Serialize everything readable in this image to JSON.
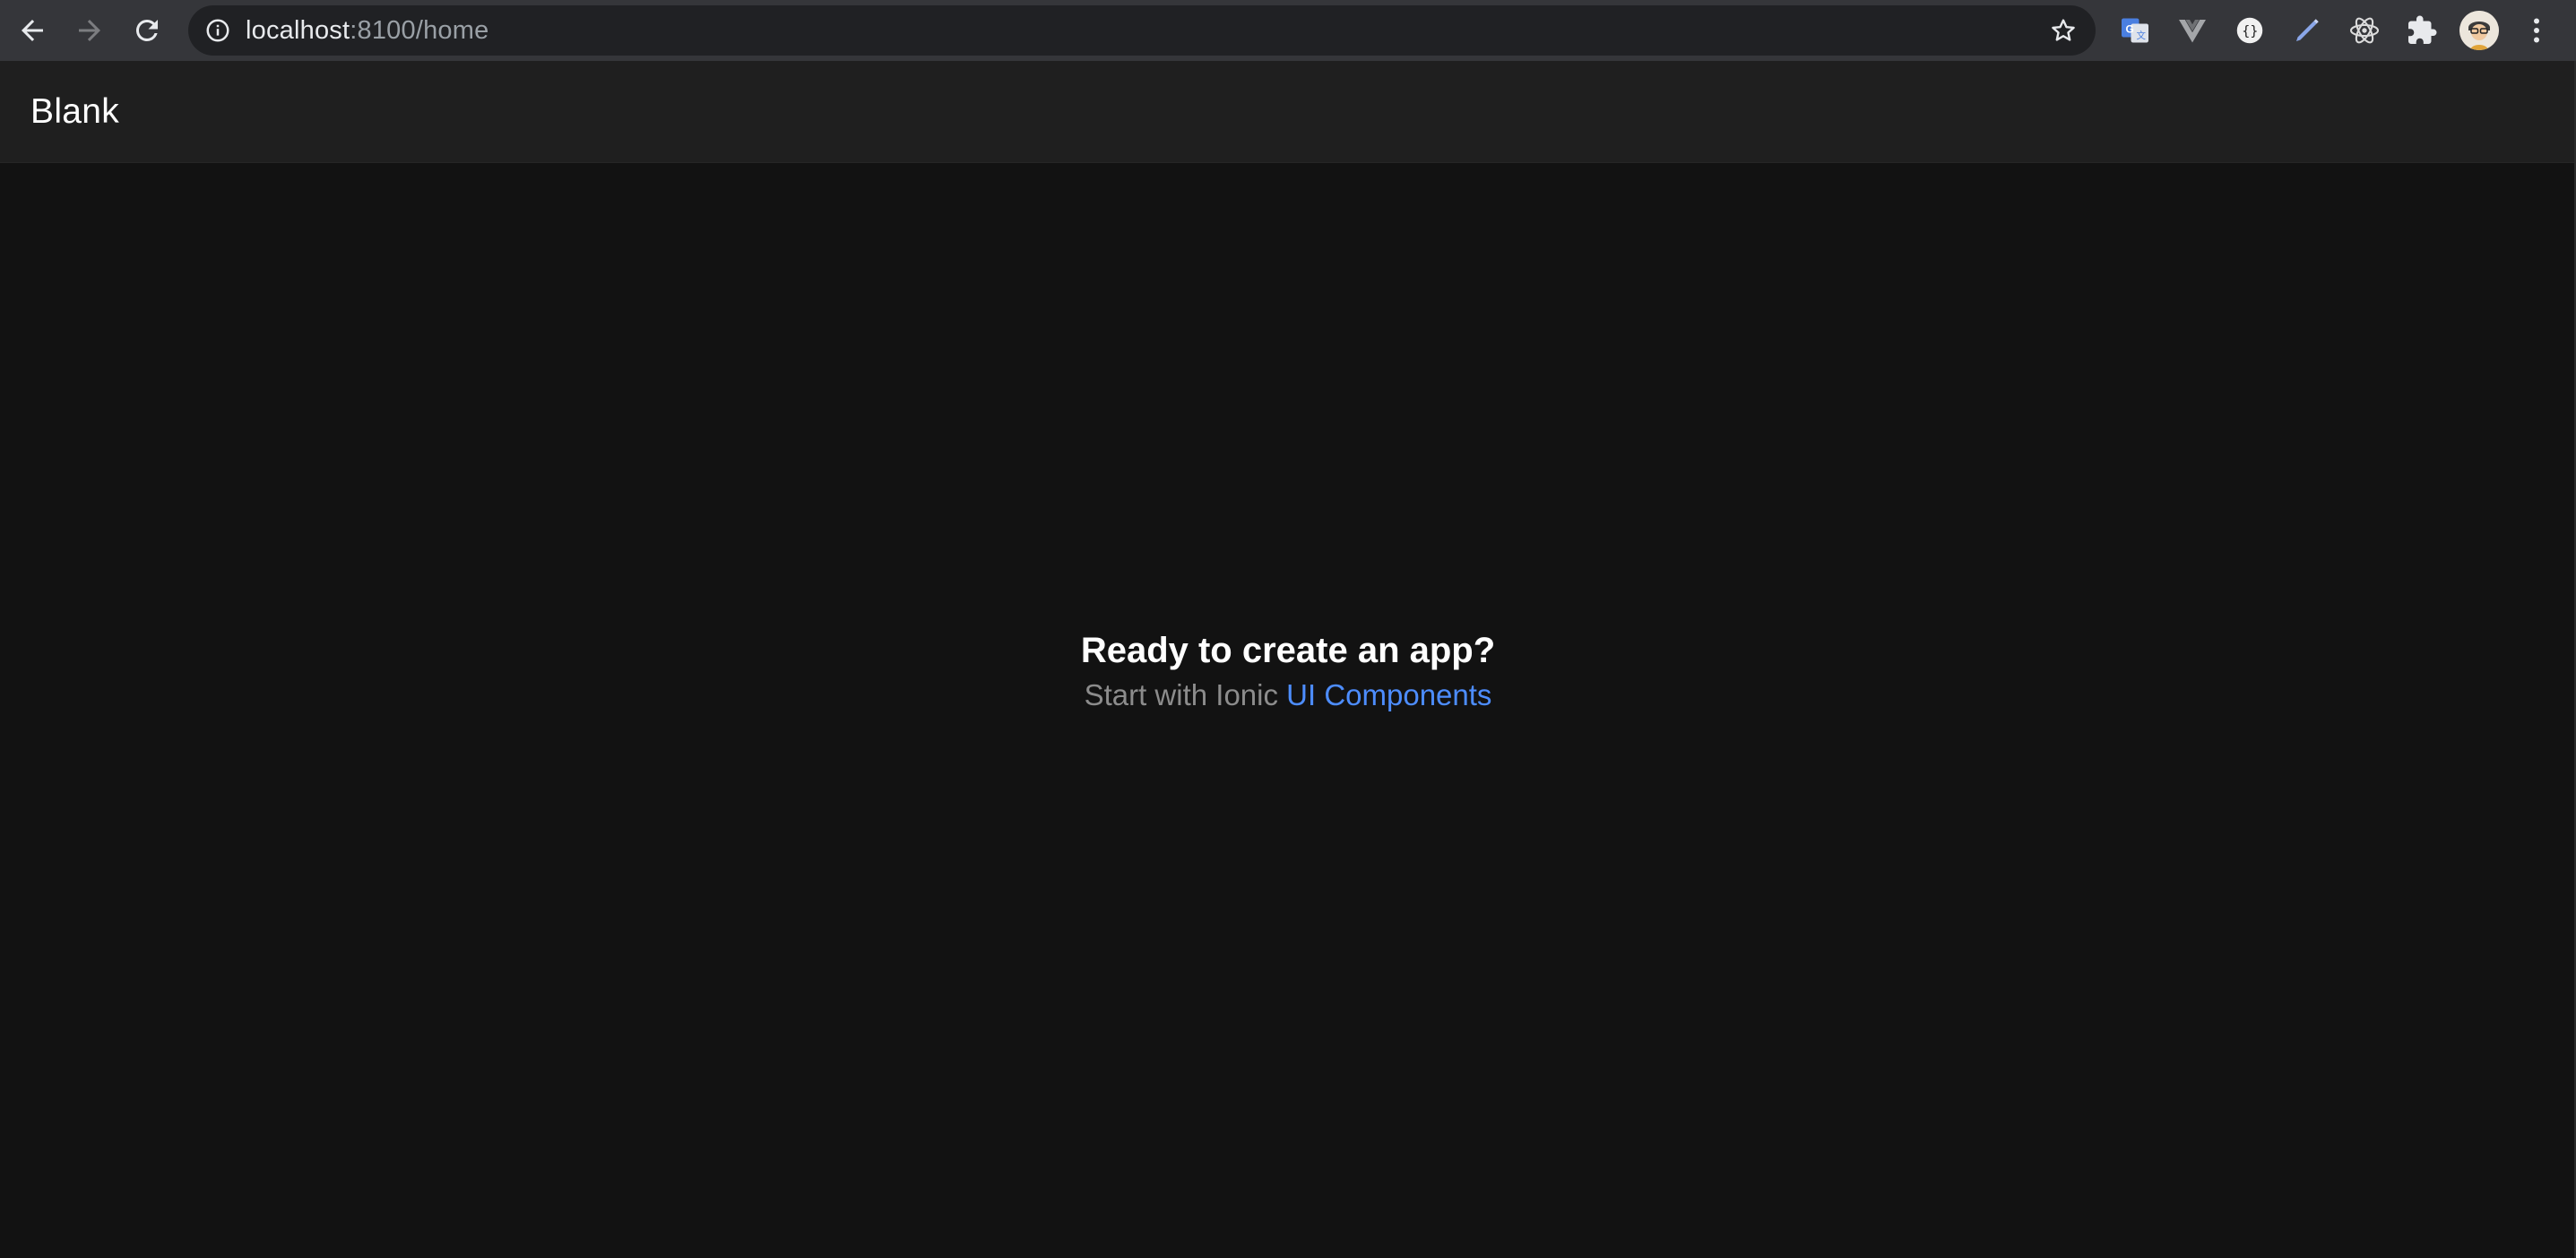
{
  "browser": {
    "url_host": "localhost",
    "url_rest": ":8100/home",
    "nav_icons": [
      "back-arrow-icon",
      "forward-arrow-icon",
      "reload-icon"
    ],
    "extension_icons": [
      "google-translate-icon",
      "vue-devtools-icon",
      "json-viewer-icon",
      "pen-tool-icon",
      "react-devtools-icon",
      "extensions-puzzle-icon",
      "profile-avatar",
      "more-vert-icon"
    ]
  },
  "toolbar": {
    "title": "Blank"
  },
  "content": {
    "headline": "Ready to create an app?",
    "subline_prefix": "Start with Ionic ",
    "link_label": "UI Components"
  },
  "colors": {
    "background": "#121212",
    "toolbar": "#1f1f1f",
    "chrome": "#35363a",
    "omnibox": "#202124",
    "link": "#4d8dff",
    "subtext": "#8c8c8c"
  }
}
